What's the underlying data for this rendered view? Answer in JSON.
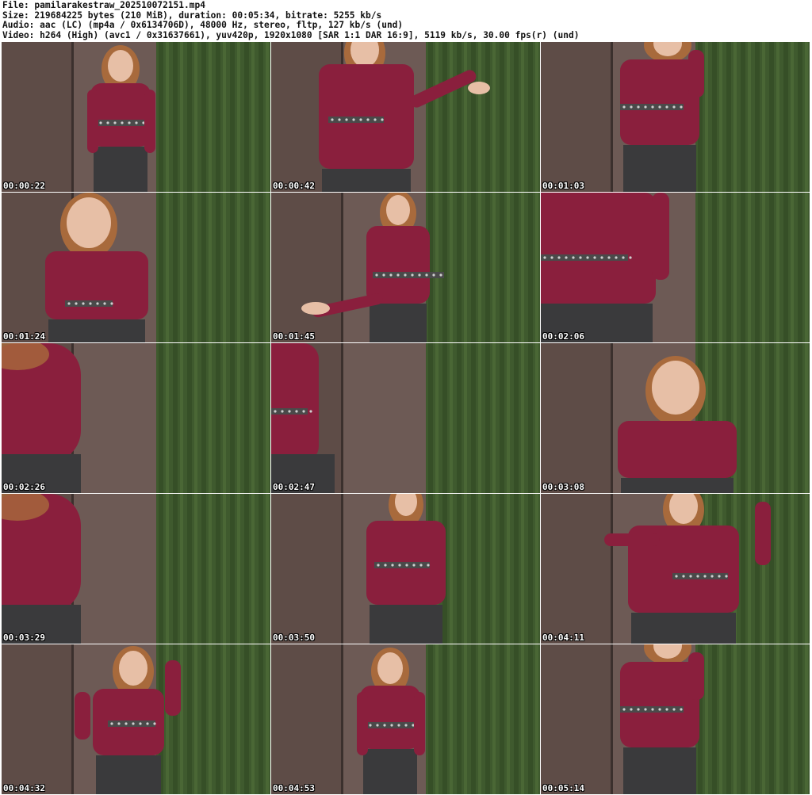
{
  "header": {
    "file_line": "File: pamilarakestraw_202510072151.mp4",
    "size_line": "Size: 219684225 bytes (210 MiB), duration: 00:05:34, bitrate: 5255 kb/s",
    "audio_line": "Audio: aac (LC) (mp4a / 0x6134706D), 48000 Hz, stereo, fltp, 127 kb/s (und)",
    "video_line": "Video: h264 (High) (avc1 / 0x31637661), yuv420p, 1920x1080 [SAR 1:1 DAR 16:9], 5119 kb/s, 30.00 fps(r) (und)"
  },
  "colors": {
    "curtain": "#3f5a2e",
    "wall": "#6d5a55",
    "top": "#8a1f3d",
    "jeans": "#3a3a3c",
    "skin": "#e7bfa6",
    "hair": "#a86a3c"
  },
  "thumbnails": [
    {
      "timestamp": "00:00:22",
      "pose": "full-standing"
    },
    {
      "timestamp": "00:00:42",
      "pose": "torso-arm-out"
    },
    {
      "timestamp": "00:01:03",
      "pose": "torso-arm-up"
    },
    {
      "timestamp": "00:01:24",
      "pose": "leaning-face"
    },
    {
      "timestamp": "00:01:45",
      "pose": "torso-hand-out"
    },
    {
      "timestamp": "00:02:06",
      "pose": "close-torso-left"
    },
    {
      "timestamp": "00:02:26",
      "pose": "edge-arm"
    },
    {
      "timestamp": "00:02:47",
      "pose": "edge-waist"
    },
    {
      "timestamp": "00:03:08",
      "pose": "close-face"
    },
    {
      "timestamp": "00:03:29",
      "pose": "edge-arm"
    },
    {
      "timestamp": "00:03:50",
      "pose": "torso-belt"
    },
    {
      "timestamp": "00:04:11",
      "pose": "torso-arms-up"
    },
    {
      "timestamp": "00:04:32",
      "pose": "full-arms-up"
    },
    {
      "timestamp": "00:04:53",
      "pose": "full-standing"
    },
    {
      "timestamp": "00:05:14",
      "pose": "torso-arm-up"
    }
  ]
}
